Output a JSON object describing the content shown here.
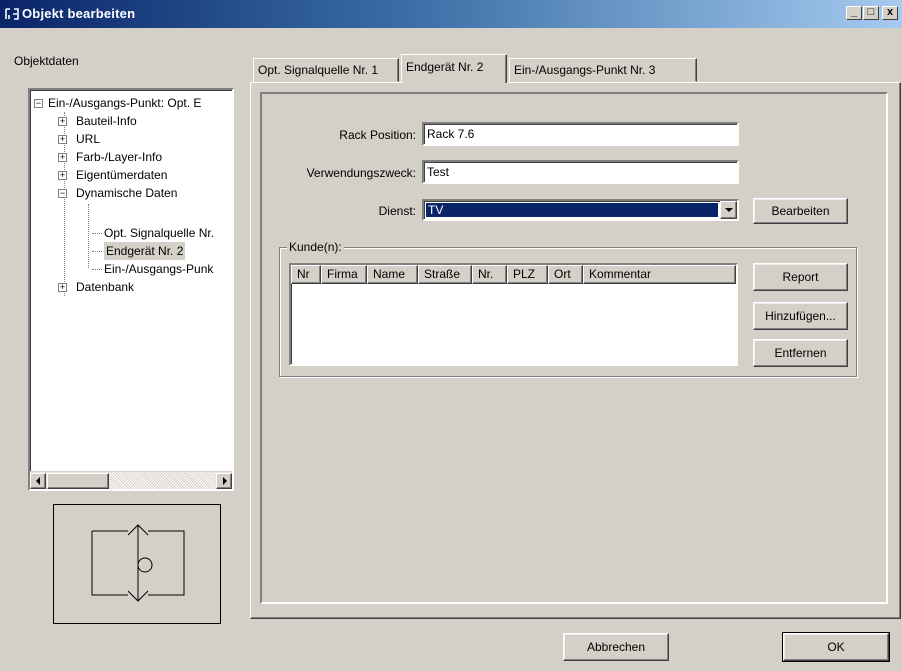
{
  "window": {
    "title": "Objekt bearbeiten",
    "minimize_glyph": "_",
    "maximize_glyph": "□",
    "close_glyph": "x"
  },
  "left_panel": {
    "label": "Objektdaten",
    "tree": [
      {
        "label": "Ein-/Ausgangs-Punkt: Opt. E",
        "level": 0,
        "expander": "−"
      },
      {
        "label": "Bauteil-Info",
        "level": 1,
        "expander": "+"
      },
      {
        "label": "URL",
        "level": 1,
        "expander": "+"
      },
      {
        "label": "Farb-/Layer-Info",
        "level": 1,
        "expander": "+"
      },
      {
        "label": "Eigentümerdaten",
        "level": 1,
        "expander": "+"
      },
      {
        "label": "Dynamische Daten",
        "level": 1,
        "expander": "−"
      },
      {
        "label": "Opt. Signalquelle Nr.",
        "level": 2
      },
      {
        "label": "Endgerät Nr. 2",
        "level": 2,
        "selected": true
      },
      {
        "label": "Ein-/Ausgangs-Punk",
        "level": 2
      },
      {
        "label": "Datenbank",
        "level": 1,
        "expander": "+"
      }
    ],
    "symbol_icon": "in-out-point-symbol-icon"
  },
  "tabs": [
    {
      "label": "Opt. Signalquelle Nr. 1",
      "active": false
    },
    {
      "label": "Endgerät Nr. 2",
      "active": true
    },
    {
      "label": "Ein-/Ausgangs-Punkt Nr. 3",
      "active": false
    }
  ],
  "form": {
    "rack_label": "Rack Position:",
    "rack_value": "Rack 7.6",
    "purpose_label": "Verwendungszweck:",
    "purpose_value": "Test",
    "service_label": "Dienst:",
    "service_value": "TV",
    "edit_button": "Bearbeiten"
  },
  "customers": {
    "group_label": "Kunde(n):",
    "columns": [
      "Nr",
      "Firma",
      "Name",
      "Straße",
      "Nr.",
      "PLZ",
      "Ort",
      "Kommentar"
    ],
    "rows": [],
    "report_button": "Report",
    "add_button": "Hinzufügen...",
    "remove_button": "Entfernen"
  },
  "footer": {
    "cancel_button": "Abbrechen",
    "ok_button": "OK"
  },
  "colors": {
    "face": "#d4d0c8",
    "selection": "#0a246a",
    "titlebar_start": "#0a246a",
    "titlebar_end": "#a6caf0"
  }
}
